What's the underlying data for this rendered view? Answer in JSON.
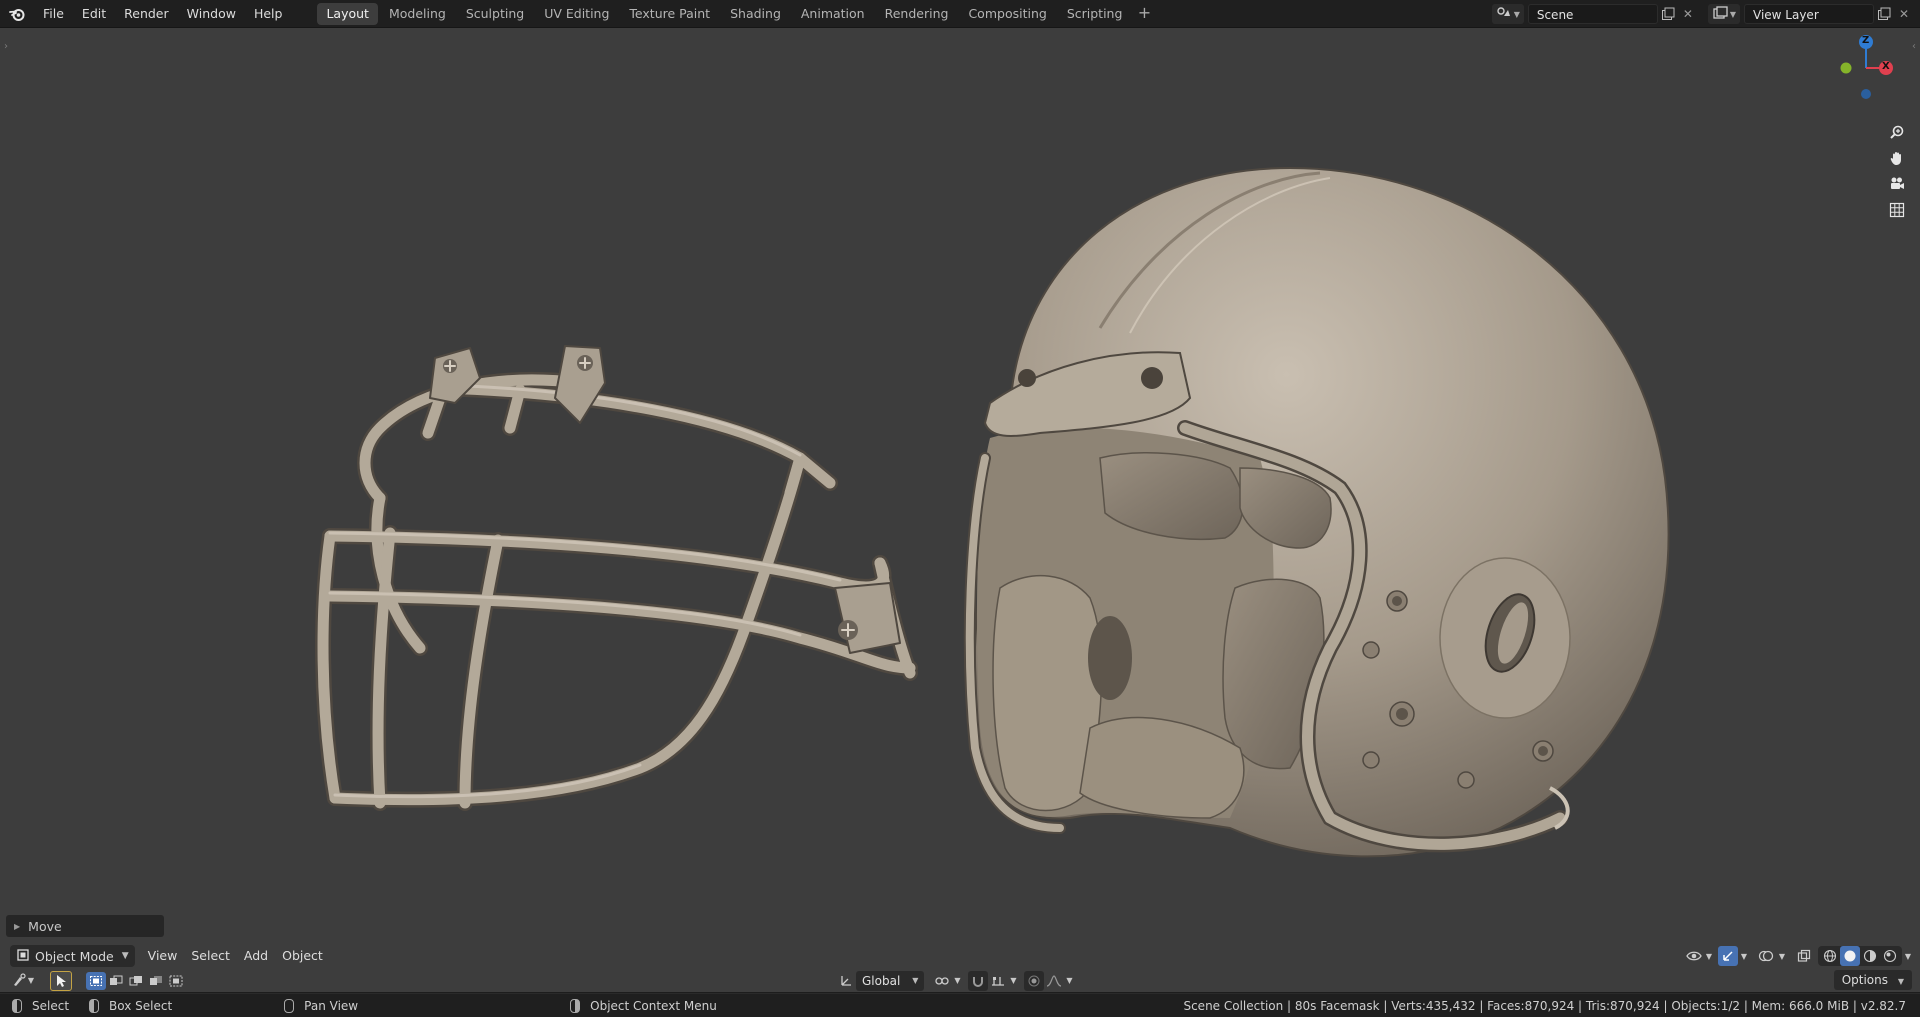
{
  "app": {
    "menus": [
      "File",
      "Edit",
      "Render",
      "Window",
      "Help"
    ]
  },
  "workspaces": [
    {
      "label": "Layout",
      "active": true
    },
    {
      "label": "Modeling",
      "active": false
    },
    {
      "label": "Sculpting",
      "active": false
    },
    {
      "label": "UV Editing",
      "active": false
    },
    {
      "label": "Texture Paint",
      "active": false
    },
    {
      "label": "Shading",
      "active": false
    },
    {
      "label": "Animation",
      "active": false
    },
    {
      "label": "Rendering",
      "active": false
    },
    {
      "label": "Compositing",
      "active": false
    },
    {
      "label": "Scripting",
      "active": false
    }
  ],
  "scene": {
    "name": "Scene",
    "view_layer": "View Layer"
  },
  "gizmo": {
    "z_label": "Z",
    "x_label": "X",
    "colors": {
      "z": "#2f7cd3",
      "x": "#e0404f",
      "y": "#85b42a"
    }
  },
  "last_operator": {
    "label": "Move"
  },
  "viewport_header": {
    "mode": "Object Mode",
    "menus": [
      "View",
      "Select",
      "Add",
      "Object"
    ]
  },
  "tool_settings": {
    "orientation": "Global",
    "options_label": "Options"
  },
  "statusbar": {
    "select": "Select",
    "box_select": "Box Select",
    "pan_view": "Pan View",
    "context_menu": "Object Context Menu",
    "stats": "Scene Collection | 80s Facemask | Verts:435,432 | Faces:870,924 | Tris:870,924 | Objects:1/2 | Mem: 666.0 MiB | v2.82.7"
  },
  "colors": {
    "viewport_bg": "#3d3d3d",
    "model": "#a69c8e",
    "active_tool": "#c4a344",
    "workspace_active": "#3d3d3d"
  }
}
